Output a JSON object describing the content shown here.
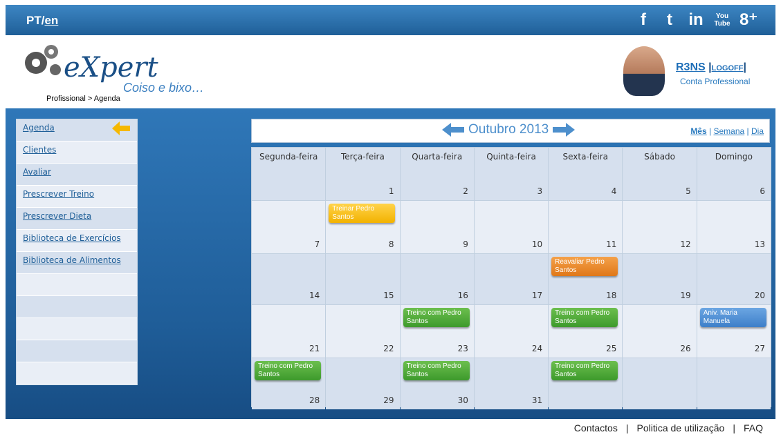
{
  "topbar": {
    "lang_pt": "PT/",
    "lang_en": "en"
  },
  "social": [
    {
      "icon": "facebook-icon",
      "label": "f"
    },
    {
      "icon": "twitter-icon",
      "label": "t"
    },
    {
      "icon": "linkedin-icon",
      "label": "in"
    },
    {
      "icon": "youtube-icon",
      "label": "You Tube"
    },
    {
      "icon": "google-plus-icon",
      "label": "8⁺"
    }
  ],
  "header": {
    "logo_name": "eXpert",
    "logo_tag": "Coiso e bixo…",
    "breadcrumb": "Profissional > Agenda",
    "user_name": "R3NS",
    "logoff": "LOGOFF",
    "user_role": "Conta Professional"
  },
  "sidebar": {
    "items": [
      "Agenda",
      "Clientes",
      "Avaliar",
      "Prescrever Treino",
      "Prescrever Dieta",
      "Biblioteca de Exercícios",
      "Biblioteca de Alimentos",
      "",
      "",
      "",
      "",
      ""
    ]
  },
  "calendar": {
    "month": "Outubro 2013",
    "views": {
      "month": "Mês",
      "week": "Semana",
      "day": "Dia",
      "sep": "|"
    },
    "days": [
      "Segunda-feira",
      "Terça-feira",
      "Quarta-feira",
      "Quinta-feira",
      "Sexta-feira",
      "Sábado",
      "Domingo"
    ],
    "weeks": [
      [
        "",
        "1",
        "2",
        "3",
        "4",
        "5",
        "6"
      ],
      [
        "7",
        "8",
        "9",
        "10",
        "11",
        "12",
        "13"
      ],
      [
        "14",
        "15",
        "16",
        "17",
        "18",
        "19",
        "20"
      ],
      [
        "21",
        "22",
        "23",
        "24",
        "25",
        "26",
        "27"
      ],
      [
        "28",
        "29",
        "30",
        "31",
        "",
        "",
        ""
      ]
    ],
    "events": [
      {
        "week": 1,
        "day": 1,
        "text": "Treinar Pedro Santos",
        "color": "yellow"
      },
      {
        "week": 2,
        "day": 4,
        "text": "Reavaliar Pedro Santos",
        "color": "orange"
      },
      {
        "week": 3,
        "day": 2,
        "text": "Treino com Pedro Santos",
        "color": "green"
      },
      {
        "week": 3,
        "day": 4,
        "text": "Treino com Pedro Santos",
        "color": "green"
      },
      {
        "week": 3,
        "day": 6,
        "text": "Aniv. Maria Manuela",
        "color": "blue"
      },
      {
        "week": 4,
        "day": 0,
        "text": "Treino com Pedro Santos",
        "color": "green"
      },
      {
        "week": 4,
        "day": 2,
        "text": "Treino com Pedro Santos",
        "color": "green"
      },
      {
        "week": 4,
        "day": 4,
        "text": "Treino com Pedro Santos",
        "color": "green"
      }
    ]
  },
  "footer": {
    "contacts": "Contactos",
    "policy": "Politica de utilização",
    "faq": "FAQ",
    "sep": "|"
  },
  "colors": {
    "primary": "#1f5f98",
    "accent_arrow": "#f5b800"
  }
}
